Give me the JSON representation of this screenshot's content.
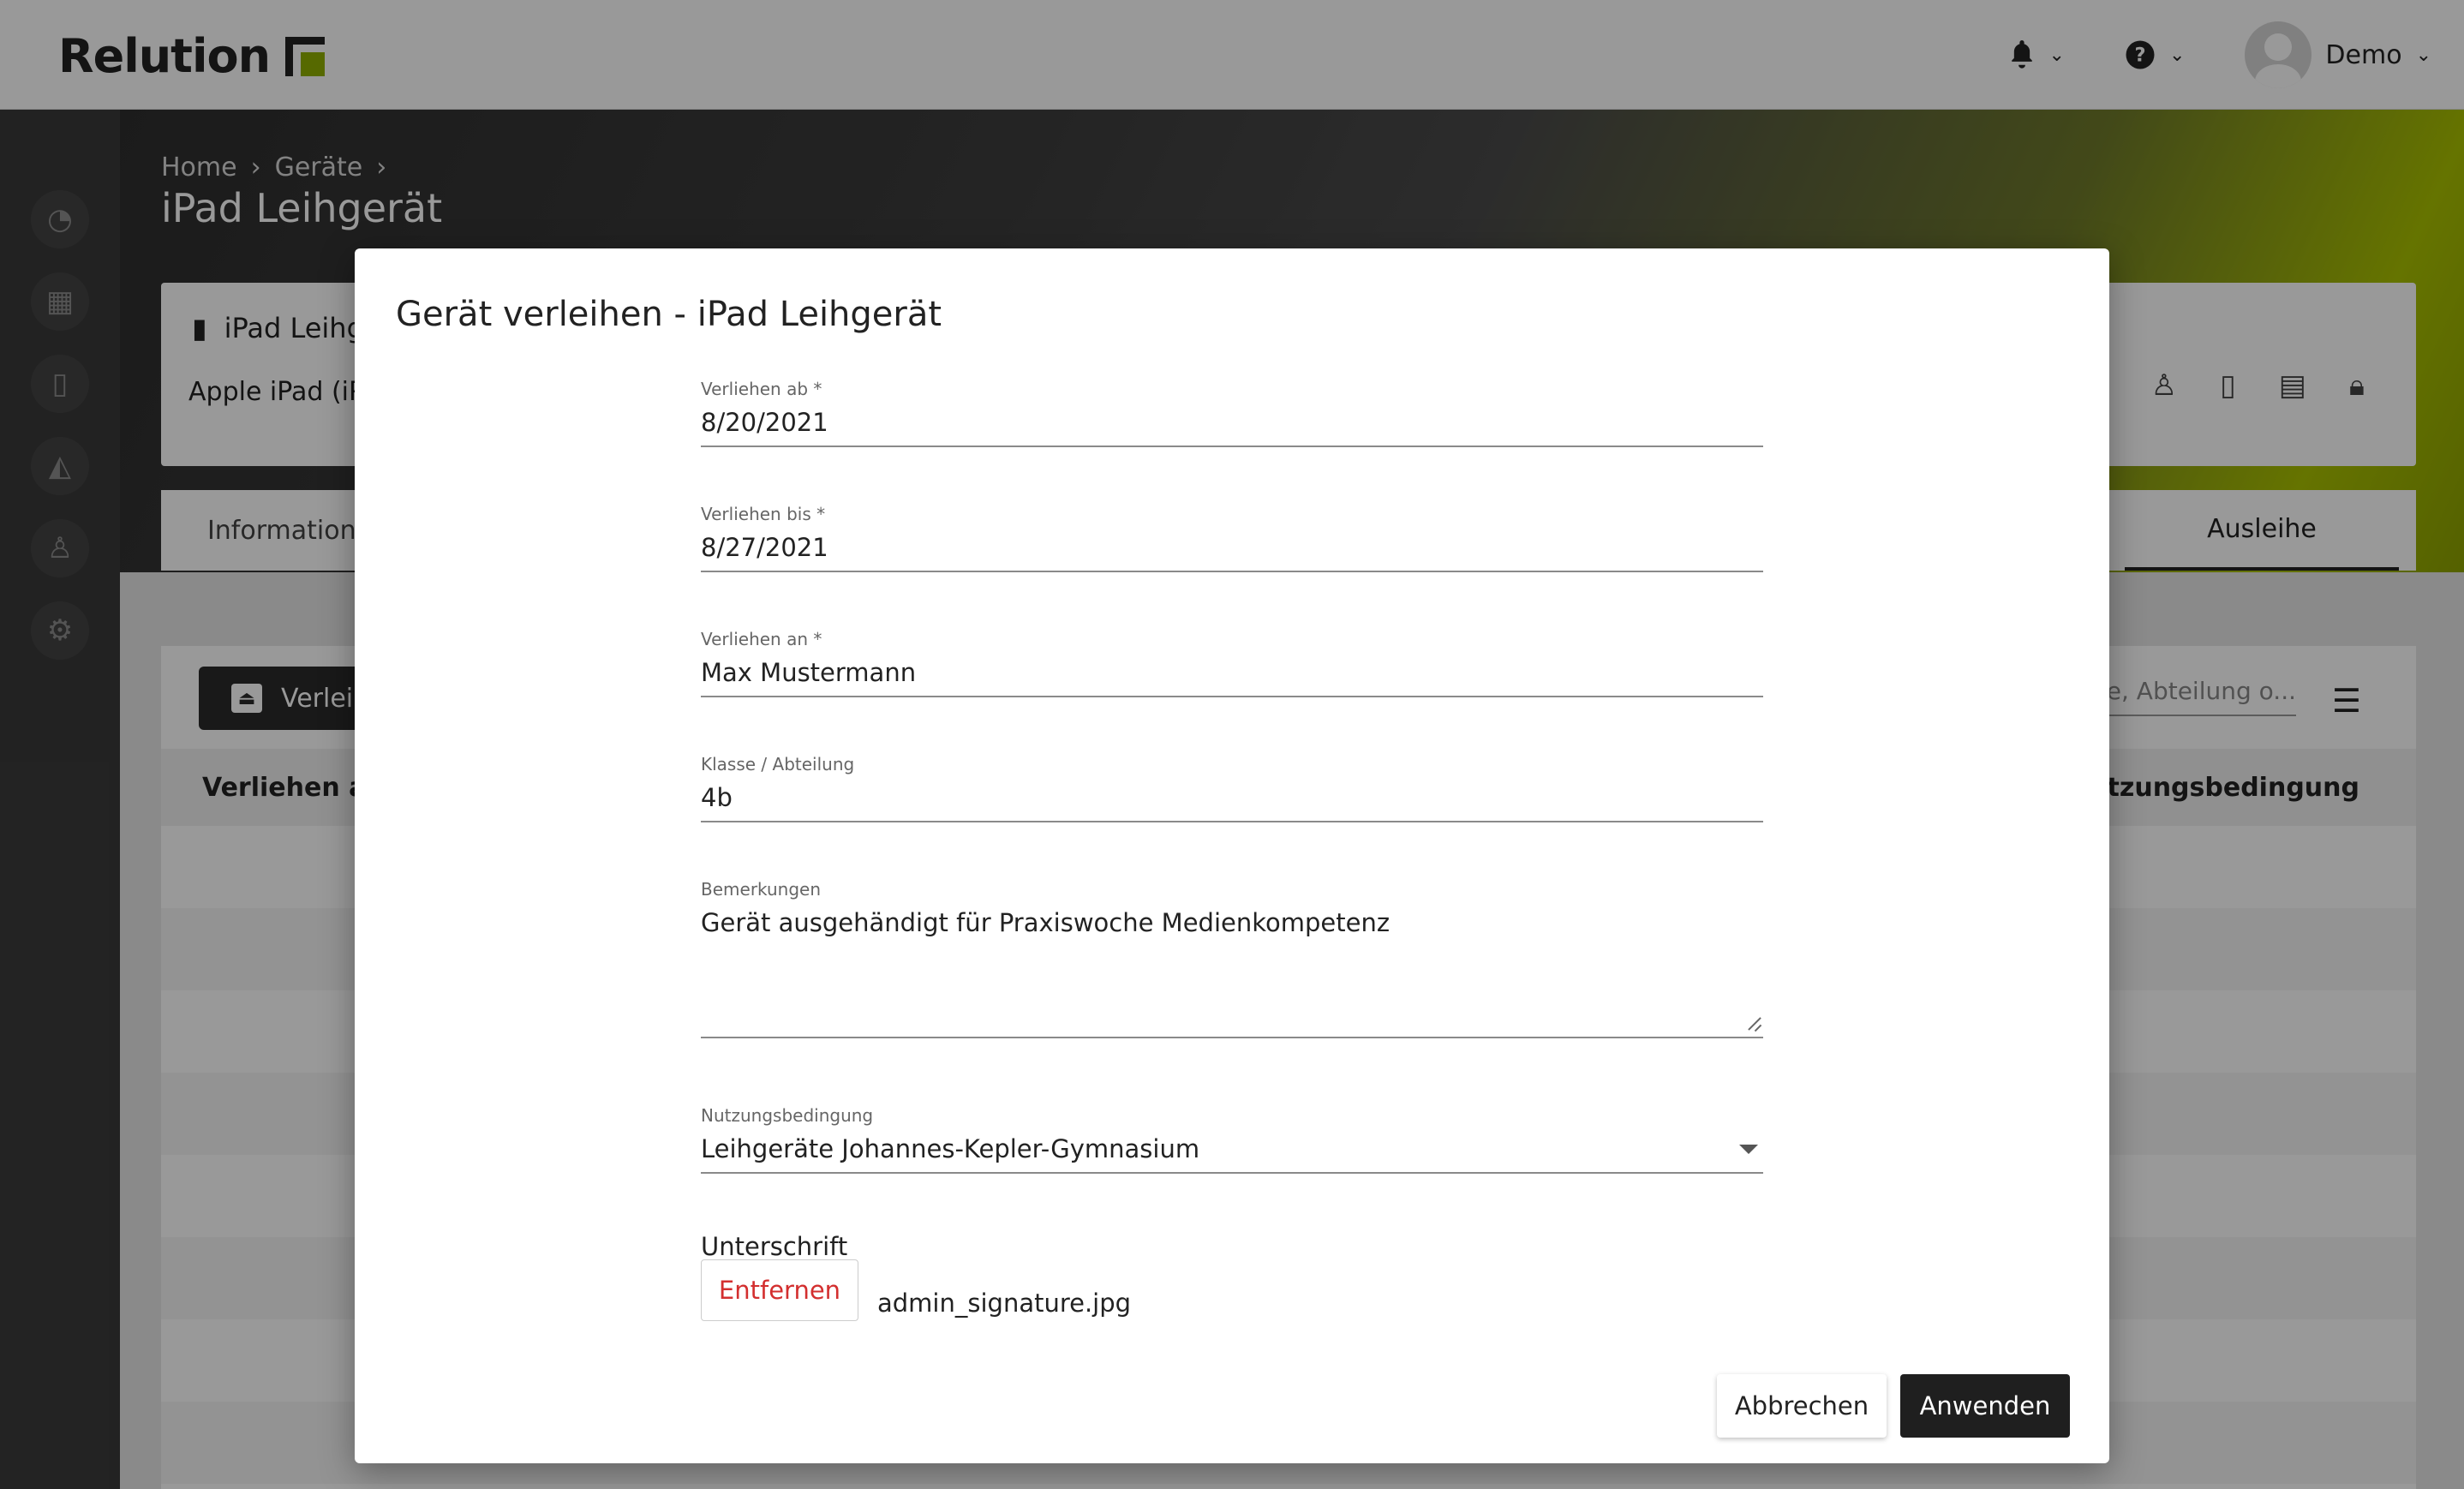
{
  "header": {
    "app_name": "Relution",
    "notifications_icon": "bell-icon",
    "help_icon": "help-icon",
    "user_name": "Demo"
  },
  "sidebar": {
    "items": [
      {
        "name": "dashboard",
        "icon": "speedometer-icon"
      },
      {
        "name": "apps",
        "icon": "grid-icon"
      },
      {
        "name": "devices",
        "icon": "smartphone-icon"
      },
      {
        "name": "education",
        "icon": "graduation-cap-icon"
      },
      {
        "name": "users",
        "icon": "user-icon"
      },
      {
        "name": "settings",
        "icon": "gear-icon"
      }
    ]
  },
  "page": {
    "breadcrumb": [
      "Home",
      "Geräte"
    ],
    "title": "iPad Leihgerät"
  },
  "device_card": {
    "name": "iPad Leihg",
    "model": "Apple iPad (iPac"
  },
  "tabs": {
    "first": "Informatione",
    "active": "Ausleihe"
  },
  "lending_table": {
    "lend_button_label": "Verleih",
    "search_placeholder": "me, Abteilung o...",
    "columns": [
      "Verliehen ab",
      "Nutzungsbedingung"
    ]
  },
  "dialog": {
    "title": "Gerät verleihen - iPad Leihgerät",
    "fields": {
      "lent_from": {
        "label": "Verliehen ab *",
        "value": "8/20/2021"
      },
      "lent_until": {
        "label": "Verliehen bis *",
        "value": "8/27/2021"
      },
      "lent_to": {
        "label": "Verliehen an *",
        "value": "Max Mustermann"
      },
      "class": {
        "label": "Klasse / Abteilung",
        "value": "4b"
      },
      "remarks": {
        "label": "Bemerkungen",
        "value": "Gerät ausgehändigt für Praxiswoche Medienkompetenz"
      },
      "terms": {
        "label": "Nutzungsbedingung",
        "value": "Leihgeräte Johannes-Kepler-Gymnasium"
      }
    },
    "signature": {
      "label": "Unterschrift",
      "remove_label": "Entfernen",
      "file_name": "admin_signature.jpg"
    },
    "cancel_label": "Abbrechen",
    "apply_label": "Anwenden"
  },
  "colors": {
    "brand_green": "#8fb000",
    "danger": "#d32f2f",
    "primary_button": "#1f1f1f"
  }
}
